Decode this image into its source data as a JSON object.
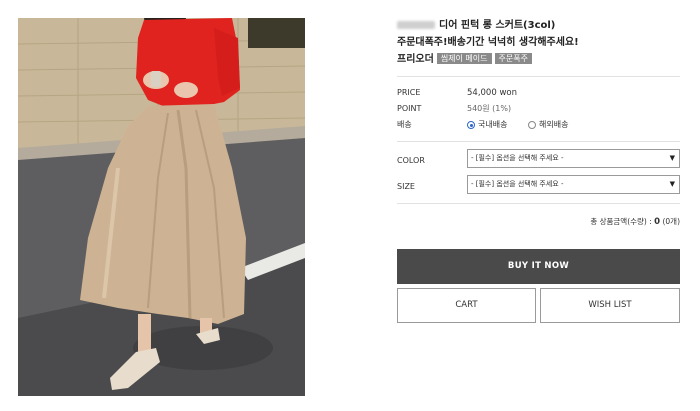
{
  "product": {
    "title": "디어 핀턱 롱 스커트(3col)",
    "subtitle": "주문대폭주!배송기간 넉넉히 생각해주세요!",
    "preorder_label": "프리오더",
    "badges": [
      "씸제이 메이드",
      "주문폭주"
    ]
  },
  "details": {
    "price_label": "PRICE",
    "price_value": "54,000 won",
    "point_label": "POINT",
    "point_value": "540원 (1%)",
    "shipping_label": "배송",
    "shipping_options": [
      "국내배송",
      "해외배송"
    ],
    "shipping_selected": "국내배송"
  },
  "options": {
    "color_label": "COLOR",
    "color_value": "- [필수] 옵션을 선택해 주세요 -",
    "size_label": "SIZE",
    "size_value": "- [필수] 옵션을 선택해 주세요 -"
  },
  "total": {
    "label": "총 상품금액(수량) :",
    "amount": "0",
    "qty": "(0개)"
  },
  "buttons": {
    "buy_now": "BUY IT NOW",
    "cart": "CART",
    "wish_list": "WISH LIST"
  },
  "colors": {
    "buy_button_bg": "#4a4a4a",
    "badge_bg": "#8a8a8a",
    "radio_selected": "#2c66c9"
  }
}
